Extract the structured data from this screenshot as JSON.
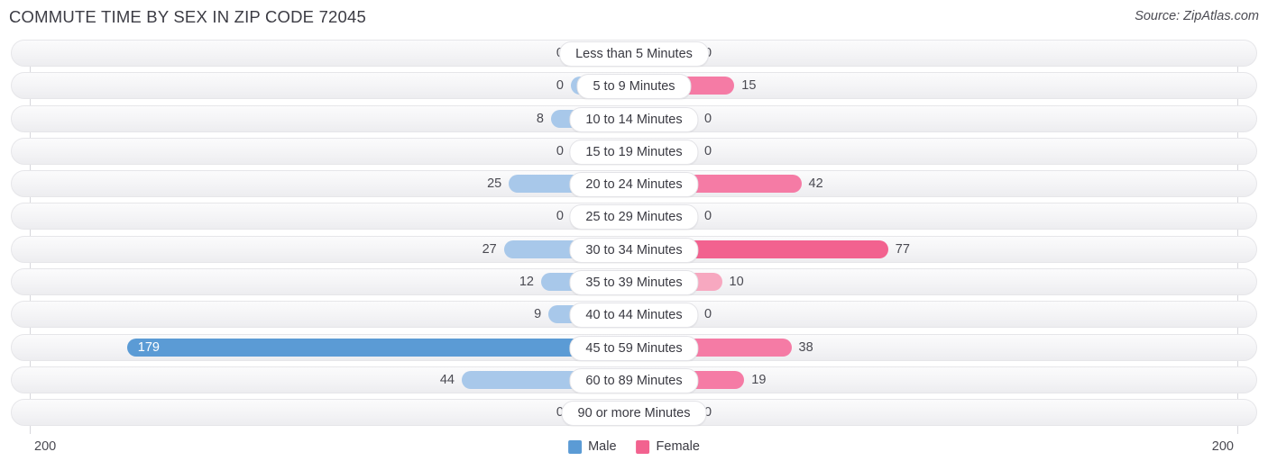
{
  "header": {
    "title": "COMMUTE TIME BY SEX IN ZIP CODE 72045",
    "source": "Source: ZipAtlas.com"
  },
  "legend": {
    "male_label": "Male",
    "female_label": "Female",
    "male_color": "#5b9bd5",
    "female_color": "#f2628f"
  },
  "axis": {
    "left_tick": "200",
    "right_tick": "200",
    "max": 200
  },
  "chart_data": {
    "type": "bar",
    "orientation": "horizontal-diverging",
    "title": "COMMUTE TIME BY SEX IN ZIP CODE 72045",
    "xlabel": "",
    "ylabel": "",
    "xlim": [
      200,
      200
    ],
    "grid": false,
    "legend_position": "bottom-center",
    "categories": [
      "Less than 5 Minutes",
      "5 to 9 Minutes",
      "10 to 14 Minutes",
      "15 to 19 Minutes",
      "20 to 24 Minutes",
      "25 to 29 Minutes",
      "30 to 34 Minutes",
      "35 to 39 Minutes",
      "40 to 44 Minutes",
      "45 to 59 Minutes",
      "60 to 89 Minutes",
      "90 or more Minutes"
    ],
    "series": [
      {
        "name": "Male",
        "color": "#5b9bd5",
        "values": [
          0,
          0,
          8,
          0,
          25,
          0,
          27,
          12,
          9,
          179,
          44,
          0
        ]
      },
      {
        "name": "Female",
        "color": "#f2628f",
        "values": [
          0,
          15,
          0,
          0,
          42,
          0,
          77,
          10,
          0,
          38,
          19,
          0
        ]
      }
    ]
  },
  "rows": [
    {
      "label": "Less than 5 Minutes",
      "male": "0",
      "female": "0"
    },
    {
      "label": "5 to 9 Minutes",
      "male": "0",
      "female": "15"
    },
    {
      "label": "10 to 14 Minutes",
      "male": "8",
      "female": "0"
    },
    {
      "label": "15 to 19 Minutes",
      "male": "0",
      "female": "0"
    },
    {
      "label": "20 to 24 Minutes",
      "male": "25",
      "female": "42"
    },
    {
      "label": "25 to 29 Minutes",
      "male": "0",
      "female": "0"
    },
    {
      "label": "30 to 34 Minutes",
      "male": "27",
      "female": "77"
    },
    {
      "label": "35 to 39 Minutes",
      "male": "12",
      "female": "10"
    },
    {
      "label": "40 to 44 Minutes",
      "male": "9",
      "female": "0"
    },
    {
      "label": "45 to 59 Minutes",
      "male": "179",
      "female": "38"
    },
    {
      "label": "60 to 89 Minutes",
      "male": "44",
      "female": "19"
    },
    {
      "label": "90 or more Minutes",
      "male": "0",
      "female": "0"
    }
  ]
}
